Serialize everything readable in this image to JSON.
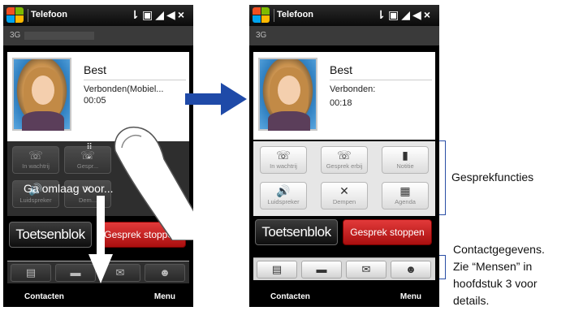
{
  "status_bar": {
    "app_title": "Telefoon",
    "icons": [
      "signal-icon",
      "sim-icon",
      "antenna-icon",
      "volume-icon",
      "close-icon"
    ],
    "close_glyph": "×"
  },
  "network": "3G",
  "left_phone": {
    "caller_name": "Best",
    "caller_status": "Verbonden(Mobiel...",
    "call_time": "00:05",
    "slide_hint": "Ga omlaag voor...",
    "visible_function_labels": [
      "In wachtrij",
      "Gespr...",
      "Luidspreker",
      "Dem..."
    ]
  },
  "right_phone": {
    "caller_name": "Best",
    "caller_status": "Verbonden:",
    "call_time": "00:18"
  },
  "functions": [
    {
      "label": "In wachtrij",
      "icon": "hold-icon"
    },
    {
      "label": "Gesprek erbij",
      "icon": "add-call-icon"
    },
    {
      "label": "Notitie",
      "icon": "note-icon"
    },
    {
      "label": "Luidspreker",
      "icon": "speaker-icon"
    },
    {
      "label": "Dempen",
      "icon": "mute-icon"
    },
    {
      "label": "Agenda",
      "icon": "calendar-icon"
    }
  ],
  "actions": {
    "keypad": "Toetsenblok",
    "end_call": "Gesprek stoppen"
  },
  "contact_tabs": [
    "contact-card-icon",
    "message-icon",
    "email-icon",
    "people-icon"
  ],
  "softkeys": {
    "left": "Contacten",
    "right": "Menu"
  },
  "annotations": {
    "functions_label": "Gesprekfuncties",
    "contact_info_line1": "Contactgegevens.",
    "contact_info_line2": "Zie “Mensen” in",
    "contact_info_line3": "hoofdstuk 3 voor",
    "contact_info_line4": "details."
  },
  "colors": {
    "accent_blue": "#1f4aa8",
    "end_call_red": "#c81d1d",
    "bracket": "#2a4ea5"
  }
}
